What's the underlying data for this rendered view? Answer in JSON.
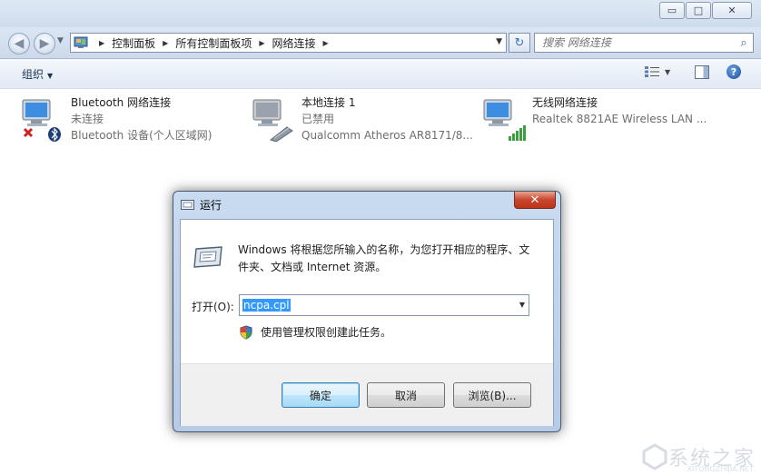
{
  "window": {
    "caption": {
      "minimize": "▭",
      "maximize": "□",
      "close": "✕"
    }
  },
  "navigation": {
    "address_crumbs": [
      "控制面板",
      "所有控制面板项",
      "网络连接"
    ],
    "search_placeholder": "搜索 网络连接"
  },
  "command_bar": {
    "organize_label": "组织"
  },
  "adapters": [
    {
      "name": "Bluetooth 网络连接",
      "status": "未连接",
      "device": "Bluetooth 设备(个人区域网)",
      "icon": "bluetooth-network-icon"
    },
    {
      "name": "本地连接 1",
      "status": "已禁用",
      "device": "Qualcomm Atheros AR8171/8...",
      "icon": "ethernet-network-icon"
    },
    {
      "name": "无线网络连接",
      "status": "",
      "device": "Realtek 8821AE Wireless LAN ...",
      "icon": "wireless-network-icon"
    }
  ],
  "run_dialog": {
    "title": "运行",
    "close_label": "✕",
    "description": "Windows 将根据您所输入的名称，为您打开相应的程序、文件夹、文档或 Internet 资源。",
    "open_label": "打开(O):",
    "open_value": "ncpa.cpl",
    "admin_note": "使用管理权限创建此任务。",
    "buttons": {
      "ok": "确定",
      "cancel": "取消",
      "browse": "浏览(B)..."
    }
  },
  "watermark": {
    "text": "系统之家",
    "url": "XITONGZHIJIA.NET"
  },
  "colors": {
    "accent": "#3399ff",
    "close_red": "#c8462e",
    "dialog_frame": "#b6cbe6"
  }
}
